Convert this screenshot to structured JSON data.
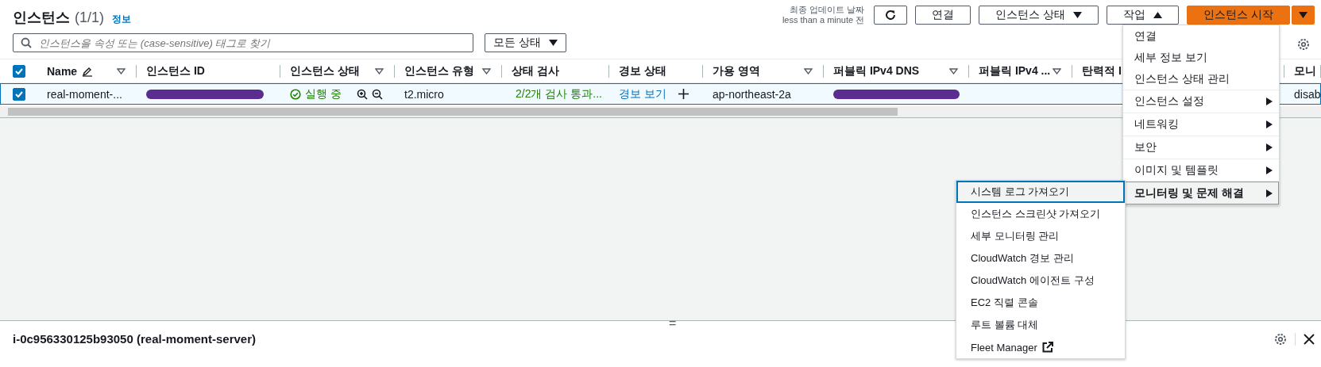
{
  "header": {
    "title": "인스턴스",
    "count": "(1/1)",
    "info_link": "정보",
    "last_updated_label": "최종 업데이트 날짜",
    "last_updated_value": "less than a minute 전"
  },
  "toolbar": {
    "buttons": [
      {
        "kind": "refresh"
      },
      {
        "kind": "plain",
        "label": "연결"
      },
      {
        "kind": "dropdown",
        "label": "인스턴스 상태",
        "expanded": false
      },
      {
        "kind": "dropdown",
        "label": "작업",
        "expanded": true
      },
      {
        "kind": "primary",
        "label": "인스턴스 시작"
      },
      {
        "kind": "primary-split"
      }
    ]
  },
  "search": {
    "placeholder": "인스턴스을 속성 또는 (case-sensitive) 태그로 찾기"
  },
  "state_filter": {
    "label": "모든 상태"
  },
  "table": {
    "select_all_checked": true,
    "columns": [
      {
        "label": "Name",
        "editable": true,
        "filter": true
      },
      {
        "label": "인스턴스 ID",
        "filter": false
      },
      {
        "label": "인스턴스 상태",
        "filter": true
      },
      {
        "label": "인스턴스 유형",
        "filter": true
      },
      {
        "label": "상태 검사",
        "filter": false
      },
      {
        "label": "경보 상태",
        "filter": false
      },
      {
        "label": "가용 영역",
        "filter": true
      },
      {
        "label": "퍼블릭 IPv4 DNS",
        "filter": true
      },
      {
        "label": "퍼블릭 IPv4 ...",
        "filter": true
      },
      {
        "label": "탄력적 I"
      },
      {
        "label": "모니"
      }
    ],
    "rows": [
      {
        "checked": true,
        "name": "real-moment-...",
        "instance_id": {
          "redacted": true
        },
        "state": "실행 중",
        "type": "t2.micro",
        "status_check": "2/2개 검사 통과...",
        "alarm": "경보 보기",
        "zone": "ap-northeast-2a",
        "public_dns": {
          "redacted": true
        },
        "monitoring": "disab"
      }
    ]
  },
  "actions_menu": {
    "items": [
      {
        "kind": "action",
        "label": "연결",
        "selected": false
      },
      {
        "kind": "action",
        "label": "세부 정보 보기",
        "selected": false
      },
      {
        "kind": "action",
        "label": "인스턴스 상태 관리",
        "selected": false
      },
      {
        "kind": "submenu",
        "label": "인스턴스 설정",
        "selected": false
      },
      {
        "kind": "submenu",
        "label": "네트워킹",
        "selected": false
      },
      {
        "kind": "submenu",
        "label": "보안",
        "selected": false
      },
      {
        "kind": "submenu",
        "label": "이미지 및 템플릿",
        "selected": false
      },
      {
        "kind": "submenu",
        "label": "모니터링 및 문제 해결",
        "selected": true
      }
    ]
  },
  "submenu": {
    "items": [
      {
        "label": "시스템 로그 가져오기",
        "selected": true,
        "external": false
      },
      {
        "label": "인스턴스 스크린샷 가져오기",
        "selected": false,
        "external": false
      },
      {
        "label": "세부 모니터링 관리",
        "selected": false,
        "external": false
      },
      {
        "label": "CloudWatch 경보 관리",
        "selected": false,
        "external": false
      },
      {
        "label": "CloudWatch 에이전트 구성",
        "selected": false,
        "external": false
      },
      {
        "label": "EC2 직렬 콘솔",
        "selected": false,
        "external": false
      },
      {
        "label": "루트 볼륨 대체",
        "selected": false,
        "external": false
      },
      {
        "label": "Fleet Manager",
        "selected": false,
        "external": true
      }
    ]
  },
  "split_handle": "=",
  "details": {
    "title": "i-0c956330125b93050 (real-moment-server)"
  }
}
